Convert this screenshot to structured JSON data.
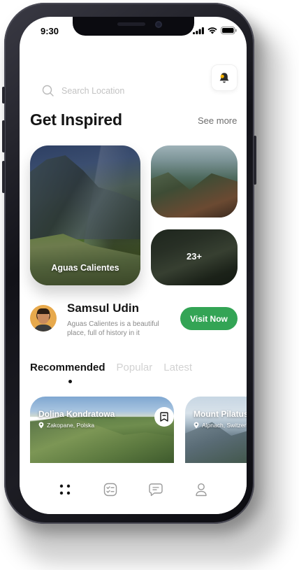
{
  "status_bar": {
    "time": "9:30"
  },
  "search": {
    "placeholder": "Search Location"
  },
  "header": {
    "title": "Get Inspired",
    "see_more": "See more"
  },
  "gallery": {
    "main_label": "Aguas Calientes",
    "more_count": "23+"
  },
  "author": {
    "name": "Samsul Udin",
    "description": "Aguas Calientes is a beautiful place, full of history in it",
    "cta": "Visit Now"
  },
  "tabs": [
    {
      "label": "Recommended",
      "active": true
    },
    {
      "label": "Popular",
      "active": false
    },
    {
      "label": "Latest",
      "active": false
    }
  ],
  "recommended": [
    {
      "title": "Dolina Kondratowa",
      "location": "Zakopane, Polska"
    },
    {
      "title": "Mount Pilatus",
      "location": "Alpnach, Switzerland"
    }
  ],
  "bottom_nav": [
    {
      "icon": "grid-dots-icon",
      "active": true
    },
    {
      "icon": "checklist-icon",
      "active": false
    },
    {
      "icon": "chat-icon",
      "active": false
    },
    {
      "icon": "profile-icon",
      "active": false
    }
  ],
  "colors": {
    "accent_green": "#33a455",
    "text_dark": "#151515",
    "text_muted": "#8a8a8a"
  }
}
